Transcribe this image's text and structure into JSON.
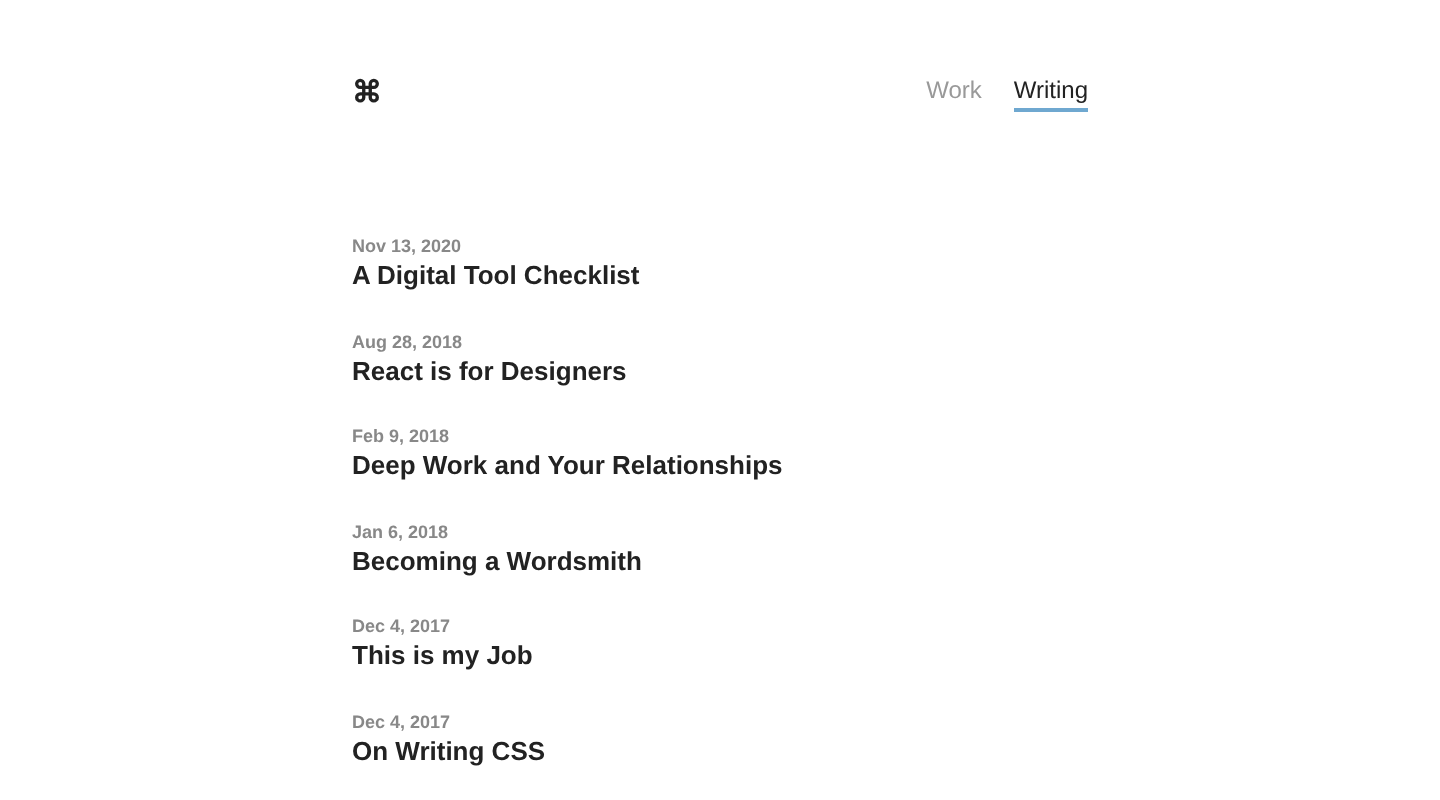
{
  "logo": "⌘",
  "nav": [
    {
      "label": "Work",
      "selected": false
    },
    {
      "label": "Writing",
      "selected": true
    }
  ],
  "posts": [
    {
      "date": "Nov 13, 2020",
      "title": "A Digital Tool Checklist"
    },
    {
      "date": "Aug 28, 2018",
      "title": "React is for Designers"
    },
    {
      "date": "Feb 9, 2018",
      "title": "Deep Work and Your Relationships"
    },
    {
      "date": "Jan 6, 2018",
      "title": "Becoming a Wordsmith"
    },
    {
      "date": "Dec 4, 2017",
      "title": "This is my Job"
    },
    {
      "date": "Dec 4, 2017",
      "title": "On Writing CSS"
    }
  ]
}
